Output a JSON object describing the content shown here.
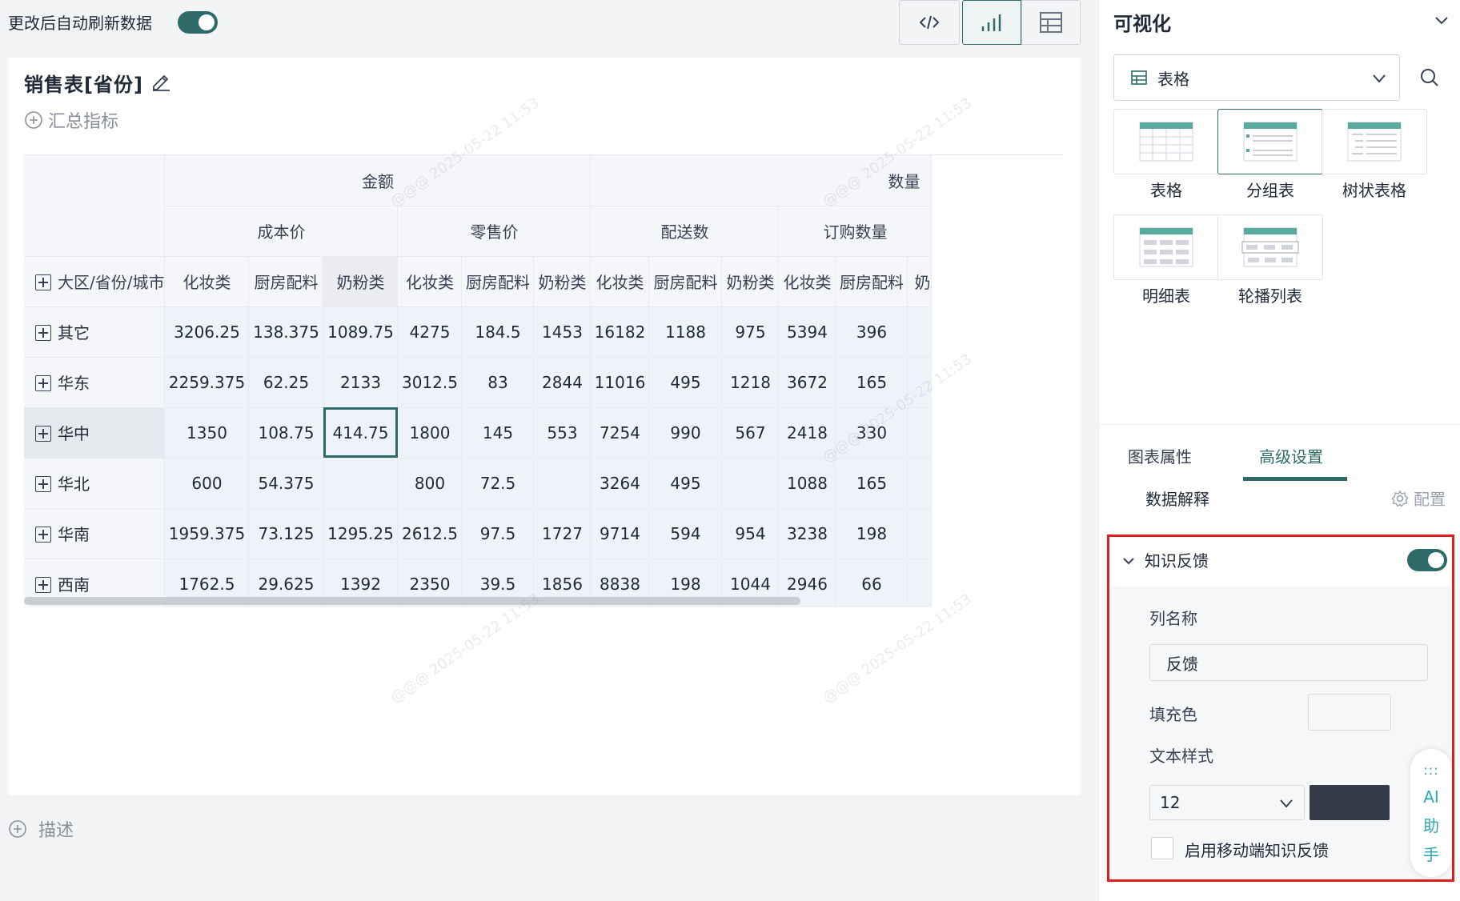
{
  "topbar": {
    "refresh_label": "更改后自动刷新数据",
    "refresh_on": true
  },
  "card": {
    "title": "销售表[省份]",
    "summary_label": "汇总指标"
  },
  "table": {
    "row_header_label": "大区/省份/城市",
    "level1": [
      {
        "label": "金额",
        "span": 6
      },
      {
        "label": "数量",
        "span": 6
      }
    ],
    "level2": [
      {
        "label": "成本价",
        "span": 3
      },
      {
        "label": "零售价",
        "span": 3
      },
      {
        "label": "配送数",
        "span": 3
      },
      {
        "label": "订购数量",
        "span": 3
      }
    ],
    "level3": [
      "化妆类",
      "厨房配料",
      "奶粉类",
      "化妆类",
      "厨房配料",
      "奶粉类",
      "化妆类",
      "厨房配料",
      "奶粉类",
      "化妆类",
      "厨房配料",
      "奶"
    ],
    "rows": [
      {
        "label": "其它",
        "cells": [
          "3206.25",
          "138.375",
          "1089.75",
          "4275",
          "184.5",
          "1453",
          "16182",
          "1188",
          "975",
          "5394",
          "396",
          ""
        ]
      },
      {
        "label": "华东",
        "cells": [
          "2259.375",
          "62.25",
          "2133",
          "3012.5",
          "83",
          "2844",
          "11016",
          "495",
          "1218",
          "3672",
          "165",
          ""
        ]
      },
      {
        "label": "华中",
        "cells": [
          "1350",
          "108.75",
          "414.75",
          "1800",
          "145",
          "553",
          "7254",
          "990",
          "567",
          "2418",
          "330",
          ""
        ]
      },
      {
        "label": "华北",
        "cells": [
          "600",
          "54.375",
          "",
          "800",
          "72.5",
          "",
          "3264",
          "495",
          "",
          "1088",
          "165",
          ""
        ]
      },
      {
        "label": "华南",
        "cells": [
          "1959.375",
          "73.125",
          "1295.25",
          "2612.5",
          "97.5",
          "1727",
          "9714",
          "594",
          "954",
          "3238",
          "198",
          ""
        ]
      },
      {
        "label": "西南",
        "cells": [
          "1762.5",
          "29.625",
          "1392",
          "2350",
          "39.5",
          "1856",
          "8838",
          "198",
          "1044",
          "2946",
          "66",
          ""
        ]
      }
    ]
  },
  "describe_label": "描述",
  "watermark_text": "@@@ 2025-05-22 11:53",
  "panel": {
    "title": "可视化",
    "chart_type_selected": "表格",
    "types": [
      {
        "label": "表格",
        "icon": "plain-table-icon"
      },
      {
        "label": "分组表",
        "icon": "group-table-icon"
      },
      {
        "label": "树状表格",
        "icon": "tree-table-icon"
      },
      {
        "label": "明细表",
        "icon": "detail-table-icon"
      },
      {
        "label": "轮播列表",
        "icon": "carousel-list-icon"
      }
    ],
    "tabs": [
      "图表属性",
      "高级设置"
    ],
    "data_explain": "数据解释",
    "config_label": "配置",
    "knowledge_feedback": {
      "title": "知识反馈",
      "enabled": true,
      "column_name_label": "列名称",
      "column_name_value": "反馈",
      "fill_color_label": "填充色",
      "text_style_label": "文本样式",
      "font_size": "12",
      "text_color": "#363b49",
      "mobile_label": "启用移动端知识反馈"
    },
    "ai_assistant": {
      "dots": ":::",
      "chars": [
        "AI",
        "助",
        "手"
      ]
    }
  },
  "colors": {
    "accent": "#2e6b68",
    "highlight_border": "#e01e1e",
    "ai_text": "#2ba8b0"
  }
}
